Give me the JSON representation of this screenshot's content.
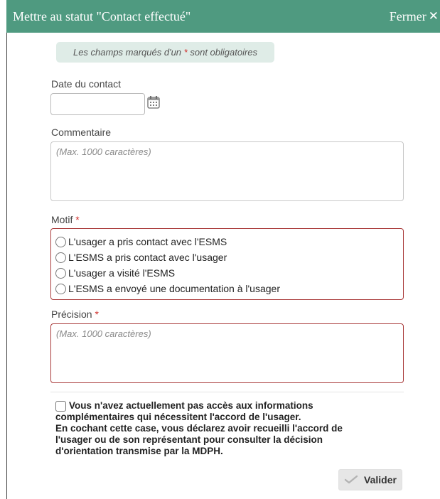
{
  "dialog": {
    "title": "Mettre au statut \"Contact effectué\"",
    "close_label": "Fermer",
    "close_icon": "close-icon",
    "header_color": "#4f9a80"
  },
  "required_note": {
    "text_before": "Les champs marqués d'un",
    "star": "*",
    "text_after": "sont obligatoires"
  },
  "date_field": {
    "label": "Date du contact",
    "value": "",
    "icon": "calendar-icon"
  },
  "comment_field": {
    "label": "Commentaire",
    "placeholder": "(Max. 1000 caractères)",
    "value": ""
  },
  "motif_field": {
    "label": "Motif",
    "required_mark": "*",
    "options": [
      "L'usager a pris contact avec l'ESMS",
      "L'ESMS a pris contact avec l'usager",
      "L'usager a visité l'ESMS",
      "L'ESMS a envoyé une documentation à l'usager"
    ],
    "selected": null
  },
  "precision_field": {
    "label": "Précision",
    "required_mark": "*",
    "placeholder": "(Max. 1000 caractères)",
    "value": ""
  },
  "consent": {
    "checked": false,
    "line1": "Vous n'avez actuellement pas accès aux informations",
    "line2": "complémentaires qui nécessitent l'accord de l'usager.",
    "line3": "En cochant cette case, vous déclarez avoir recueilli l'accord de",
    "line4": "l'usager ou de son représentant pour consulter la décision",
    "line5": "d'orientation transmise par la MDPH."
  },
  "actions": {
    "validate_label": "Valider",
    "validate_icon": "checkmark-icon"
  },
  "colors": {
    "required_star": "#d0312d",
    "error_border": "#a93a3a",
    "note_background": "#dfece7"
  }
}
